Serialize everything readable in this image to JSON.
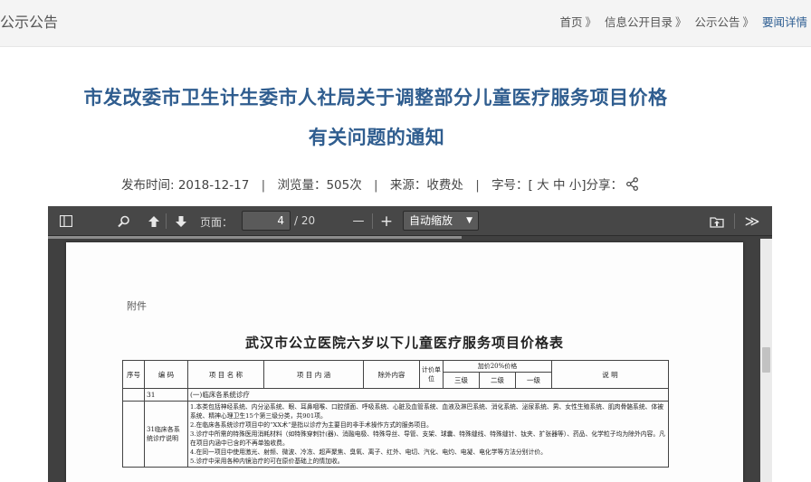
{
  "header": {
    "section_title": "公示公告",
    "breadcrumb": [
      {
        "label": "首页"
      },
      {
        "label": "信息公开目录"
      },
      {
        "label": "公示公告"
      },
      {
        "label": "要闻详情"
      }
    ],
    "separator": "》"
  },
  "article": {
    "title_line1": "市发改委市卫生计生委市人社局关于调整部分儿童医疗服务项目价格",
    "title_line2": "有关问题的通知",
    "publish_label": "发布时间:",
    "publish_date": "2018-12-17",
    "views_label": "浏览量：",
    "views": "505次",
    "source_label": "来源：",
    "source": "收费处",
    "font_size_label": "字号：[",
    "font_large": "大",
    "font_medium": "中",
    "font_small": "小",
    "font_size_close": "]",
    "share_label": "分享：",
    "divider": "|"
  },
  "pdf_viewer": {
    "page_label": "页面：",
    "current_page": "4",
    "total_pages": "/ 20",
    "zoom_minus": "—",
    "zoom_plus": "+",
    "zoom_value": "自动缩放",
    "zoom_caret": "▼",
    "more": "≫"
  },
  "document": {
    "attachment": "附件",
    "title": "武汉市公立医院六岁以下儿童医疗服务项目价格表",
    "table": {
      "headers": {
        "seq": "序号",
        "code": "编  码",
        "item_name": "项 目 名 称",
        "item_content": "项 目 内 涵",
        "exclusions": "除外内容",
        "unit": "计价单位",
        "markup": "加价20%价格",
        "grade3": "三级",
        "grade2": "二级",
        "grade1": "一级",
        "notes": "说  明"
      },
      "row1": {
        "code": "31",
        "name": "(一)临床各系统诊疗"
      },
      "row2": {
        "label": "31临床各系统诊疗说明",
        "lines": [
          "1.本类包括神经系统、内分泌系统、眼、耳鼻咽喉、口腔颌面、呼吸系统、心脏及血管系统、血液及淋巴系统、消化系统、泌尿系统、男、女性生殖系统、肌肉骨骼系统、体被系统、精神心理卫生15个第三级分类，共901项。",
          "2.在临床各系统诊疗项目中的“XX术”是指以诊疗为主要目的非手术操作方式的服务项目。",
          "3.诊疗中所需的特殊医用消耗材料（如特殊穿刺针(器)、消融电极、特殊导丝、导管、支架、球囊、特殊缝线、特殊缝针、钛夹、扩张器等）、药品、化学粒子均为除外内容。凡在项目内涵中已含的不再单独收费。",
          "4.在同一项目中使用激光、射频、微波、冷冻、超声聚焦、臭氧、离子、红外、电切、汽化、电灼、电凝、电化学等方法分别计价。",
          "5.诊疗中采用各种内镜治疗的可在原价基础上的情加收。"
        ]
      }
    }
  },
  "colors": {
    "title_blue": "#2f5d8f",
    "toolbar_bg": "#474747",
    "viewer_bg": "#404040"
  }
}
